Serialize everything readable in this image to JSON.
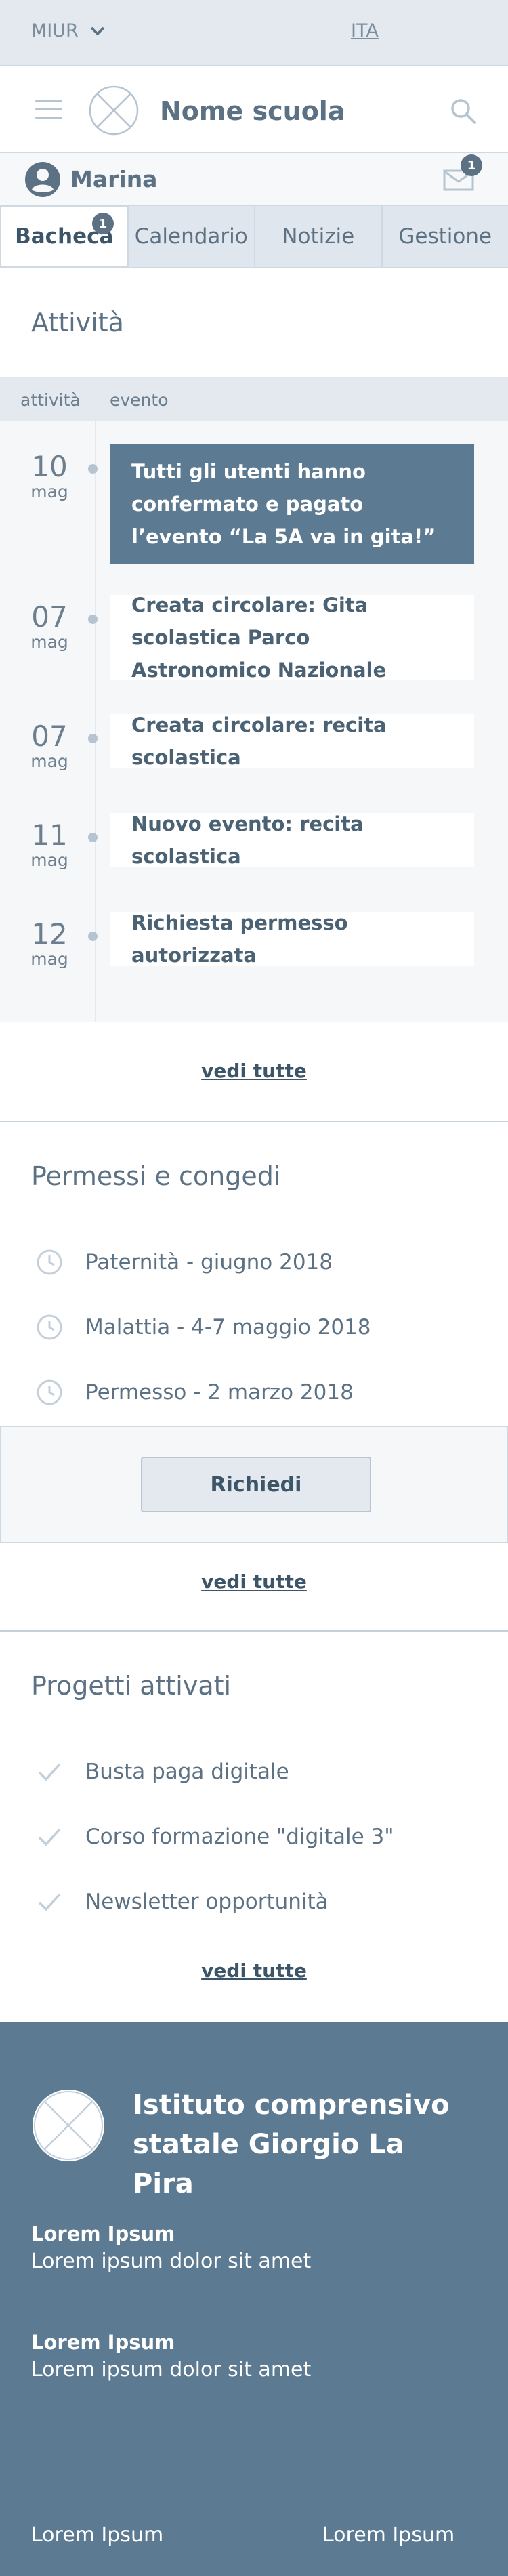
{
  "topbar": {
    "miur": "MIUR",
    "lang": "ITA"
  },
  "header": {
    "school_name": "Nome scuola"
  },
  "user": {
    "name": "Marina",
    "mail_count": "1"
  },
  "tabs": [
    {
      "label": "Bacheca",
      "badge": "1"
    },
    {
      "label": "Calendario"
    },
    {
      "label": "Notizie"
    },
    {
      "label": "Gestione"
    }
  ],
  "activities": {
    "title": "Attività",
    "columns": [
      "attività",
      "evento"
    ],
    "events": [
      {
        "day": "10",
        "month": "mag",
        "text": "Tutti gli utenti hanno confermato e pagato l’evento “La 5A va in gita!”"
      },
      {
        "day": "07",
        "month": "mag",
        "text": "Creata circolare: Gita scolastica Parco Astronomico Nazionale"
      },
      {
        "day": "07",
        "month": "mag",
        "text": "Creata circolare: recita scolastica"
      },
      {
        "day": "11",
        "month": "mag",
        "text": "Nuovo evento: recita scolastica"
      },
      {
        "day": "12",
        "month": "mag",
        "text": "Richiesta permesso autorizzata"
      }
    ],
    "see_all": "vedi tutte"
  },
  "leaves": {
    "title": "Permessi e congedi",
    "items": [
      "Paternità - giugno 2018",
      "Malattia - 4-7 maggio 2018",
      "Permesso - 2 marzo 2018"
    ],
    "request_button": "Richiedi",
    "see_all": "vedi tutte"
  },
  "projects": {
    "title": "Progetti attivati",
    "items": [
      "Busta paga digitale",
      "Corso formazione \"digitale 3\"",
      "Newsletter opportunità"
    ],
    "see_all": "vedi tutte"
  },
  "footer": {
    "institute": "Istituto comprensivo statale Giorgio La Pira",
    "blocks": [
      {
        "heading": "Lorem Ipsum",
        "text": "Lorem ipsum dolor sit amet"
      },
      {
        "heading": "Lorem Ipsum",
        "text": "Lorem ipsum dolor sit amet"
      }
    ],
    "links": [
      "Lorem Ipsum",
      "Lorem Ipsum"
    ]
  },
  "colors": {
    "primary": "#5c7a91",
    "text": "#5c7183",
    "light_bg": "#e4e9f0"
  }
}
